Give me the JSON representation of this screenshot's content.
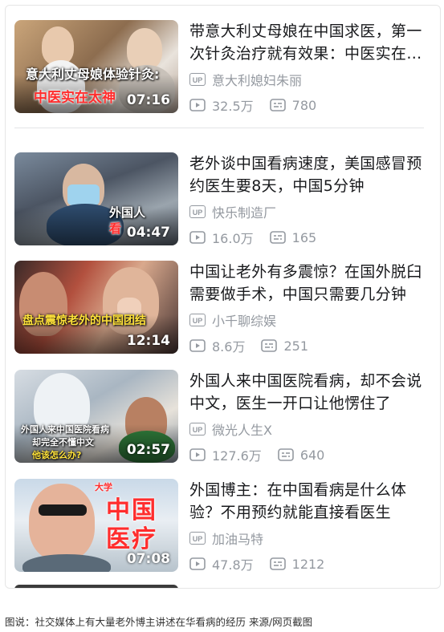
{
  "videos": [
    {
      "title": "带意大利丈母娘在中国求医，第一次针灸治疗就有效果：中医实在太神奇了",
      "author": "意大利媳妇朱丽",
      "views": "32.5万",
      "danmaku": "780",
      "duration": "07:16",
      "thumb_caption_1": "意大利丈母娘体验针灸:",
      "thumb_caption_2": "中医实在太神"
    },
    {
      "title": "老外谈中国看病速度，美国感冒预约医生要8天，中国5分钟",
      "author": "快乐制造厂",
      "views": "16.0万",
      "danmaku": "165",
      "duration": "04:47",
      "thumb_caption_1": "外国人",
      "thumb_caption_2": "看"
    },
    {
      "title": "中国让老外有多震惊？在国外脱臼需要做手术，中国只需要几分钟",
      "author": "小千聊综娱",
      "views": "8.6万",
      "danmaku": "251",
      "duration": "12:14",
      "thumb_caption_1": "盘点震惊老外的中国团结",
      "thumb_caption_2": ""
    },
    {
      "title": "外国人来中国医院看病，却不会说中文，医生一开口让他愣住了",
      "author": "微光人生X",
      "views": "127.6万",
      "danmaku": "640",
      "duration": "02:57",
      "thumb_caption_1": "外国人来中国医院看病",
      "thumb_caption_2": "却完全不懂中文",
      "thumb_caption_3": "他该怎么办?"
    },
    {
      "title": "外国博主：在中国看病是什么体验？不用预约就能直接看医生",
      "author": "加油马特",
      "views": "47.8万",
      "danmaku": "1212",
      "duration": "07:08",
      "thumb_caption_1": "中国",
      "thumb_caption_2": "医疗",
      "thumb_caption_3": "大学"
    }
  ],
  "up_badge": "UP",
  "icons": [
    "up-badge-icon",
    "play-count-icon",
    "danmaku-icon"
  ],
  "caption": "图说：社交媒体上有大量老外博主讲述在华看病的经历 来源/网页截图",
  "colors": {
    "title": "#18191c",
    "meta": "#9499a0",
    "divider": "#e3e5e7"
  }
}
